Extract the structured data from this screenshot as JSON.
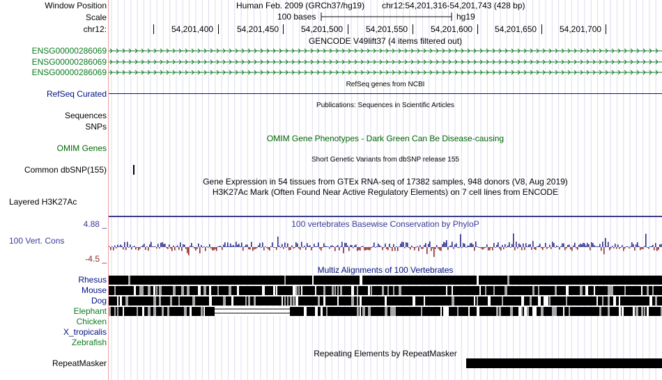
{
  "position": {
    "label": "Window Position",
    "assembly": "Human Feb. 2009 (GRCh37/hg19)",
    "range": "chr12:54,201,316-54,201,743 (428 bp)"
  },
  "scale": {
    "label": "Scale",
    "bar_text": "100 bases",
    "db": "hg19"
  },
  "ruler": {
    "label": "chr12:",
    "ticks": [
      "54,201,400",
      "54,201,450",
      "54,201,500",
      "54,201,550",
      "54,201,600",
      "54,201,650",
      "54,201,700"
    ]
  },
  "gencode": {
    "title": "GENCODE V49lift37 (4 items filtered out)",
    "items": [
      "ENSG00000286069",
      "ENSG00000286069",
      "ENSG00000286069"
    ],
    "color": "#0a7a1f"
  },
  "refseq": {
    "label": "RefSeq Curated",
    "title": "RefSeq genes from NCBI"
  },
  "publications": {
    "title": "Publications: Sequences in Scientific Articles"
  },
  "sequences": {
    "label": "Sequences"
  },
  "snps": {
    "label": "SNPs"
  },
  "omim": {
    "title": "OMIM Gene Phenotypes - Dark Green Can Be Disease-causing",
    "label": "OMIM Genes"
  },
  "dbsnp": {
    "title": "Short Genetic Variants from dbSNP release 155",
    "label": "Common dbSNP(155)"
  },
  "gtex": {
    "title": "Gene Expression in 54 tissues from GTEx RNA-seq of 17382 samples, 948 donors (V8, Aug 2019)"
  },
  "h3k27ac": {
    "title": "H3K27Ac Mark (Often Found Near Active Regulatory Elements) on 7 cell lines from ENCODE",
    "label": "Layered H3K27Ac"
  },
  "cons": {
    "title": "100 vertebrates Basewise Conservation by PhyloP",
    "label": "100 Vert. Cons",
    "max": "4.88 _",
    "min": "-4.5 _",
    "pos_color": "#2a2a8c",
    "neg_color": "#8c2a2a"
  },
  "multiz": {
    "title": "Multiz Alignments of 100 Vertebrates",
    "species": [
      "Rhesus",
      "Mouse",
      "Dog",
      "Elephant",
      "Chicken",
      "X_tropicalis",
      "Zebrafish"
    ]
  },
  "repeatmasker": {
    "title": "Repeating Elements by RepeatMasker",
    "label": "RepeatMasker"
  }
}
